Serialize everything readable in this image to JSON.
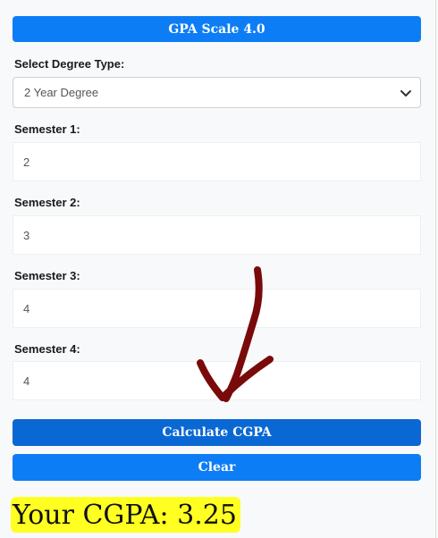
{
  "header": {
    "label": "GPA Scale 4.0"
  },
  "degree": {
    "label": "Select Degree Type:",
    "selected": "2 Year Degree"
  },
  "semesters": [
    {
      "label": "Semester 1:",
      "value": "2"
    },
    {
      "label": "Semester 2:",
      "value": "3"
    },
    {
      "label": "Semester 3:",
      "value": "4"
    },
    {
      "label": "Semester 4:",
      "value": "4"
    }
  ],
  "actions": {
    "calculate_label": "Calculate CGPA",
    "clear_label": "Clear"
  },
  "result": {
    "text": "Your CGPA: 3.25"
  },
  "annotation": {
    "icon": "hand-drawn-arrow-icon",
    "color": "#7a0a0a"
  },
  "colors": {
    "primary": "#0d7df5",
    "highlight": "#ffff22"
  }
}
